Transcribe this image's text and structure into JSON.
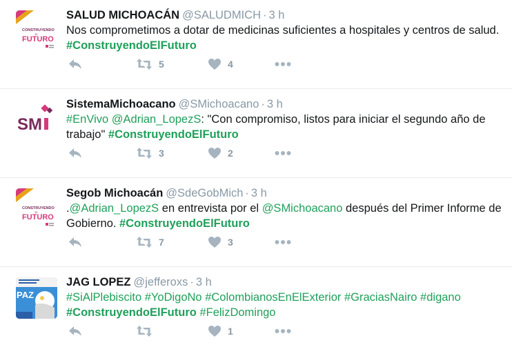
{
  "colors": {
    "link": "#1fa05a",
    "muted": "#8899a6",
    "icon": "#a5b4bf"
  },
  "tweets": [
    {
      "avatar": {
        "type": "construyendo-futuro-logo",
        "line1": "CONSTRUYENDO",
        "line2": "EL",
        "line3": "FUTURO"
      },
      "name": "SALUD MICHOACÁN",
      "handle": "@SALUDMICH",
      "time": "3 h",
      "text_parts": [
        {
          "t": "Nos comprometimos a dotar de medicinas suficientes a hospitales y centros de salud. "
        },
        {
          "t": "#ConstruyendoElFuturo",
          "c": "tag bold"
        }
      ],
      "reply_count": "",
      "retweet_count": "5",
      "like_count": "4"
    },
    {
      "avatar": {
        "type": "sm-logo",
        "line1": "SM"
      },
      "name": "SistemaMichoacano",
      "handle": "@SMichoacano",
      "time": "3 h",
      "text_parts": [
        {
          "t": "#EnVivo",
          "c": "tag"
        },
        {
          "t": " "
        },
        {
          "t": "@Adrian_LopezS",
          "c": "mention"
        },
        {
          "t": ": \"Con compromiso, listos para iniciar el segundo año de trabajo\" "
        },
        {
          "t": "#ConstruyendoElFuturo",
          "c": "tag bold"
        }
      ],
      "reply_count": "",
      "retweet_count": "3",
      "like_count": "2"
    },
    {
      "avatar": {
        "type": "construyendo-futuro-logo",
        "line1": "CONSTRUYENDO",
        "line2": "EL",
        "line3": "FUTURO"
      },
      "name": "Segob Michoacán",
      "handle": "@SdeGobMich",
      "time": "3 h",
      "text_parts": [
        {
          "t": "."
        },
        {
          "t": "@Adrian_LopezS",
          "c": "mention"
        },
        {
          "t": " en entrevista por el "
        },
        {
          "t": "@SMichoacano",
          "c": "mention"
        },
        {
          "t": " después del Primer Informe de Gobierno. "
        },
        {
          "t": "#ConstruyendoElFuturo",
          "c": "tag bold"
        }
      ],
      "reply_count": "",
      "retweet_count": "7",
      "like_count": "3"
    },
    {
      "avatar": {
        "type": "paz-image",
        "line1": "PAZ"
      },
      "name": "JAG LOPEZ",
      "handle": "@jefferoxs",
      "time": "3 h",
      "text_parts": [
        {
          "t": "#SiAlPlebiscito",
          "c": "tag"
        },
        {
          "t": " "
        },
        {
          "t": "#YoDigoNo",
          "c": "tag"
        },
        {
          "t": " "
        },
        {
          "t": "#ColombianosEnElExterior",
          "c": "tag"
        },
        {
          "t": " "
        },
        {
          "t": "#GraciasNairo",
          "c": "tag"
        },
        {
          "t": " "
        },
        {
          "t": "#digano",
          "c": "tag"
        },
        {
          "t": " "
        },
        {
          "t": "#ConstruyendoElFuturo",
          "c": "tag bold"
        },
        {
          "t": " "
        },
        {
          "t": "#FelizDomingo",
          "c": "tag"
        }
      ],
      "reply_count": "",
      "retweet_count": "",
      "like_count": "1"
    }
  ]
}
